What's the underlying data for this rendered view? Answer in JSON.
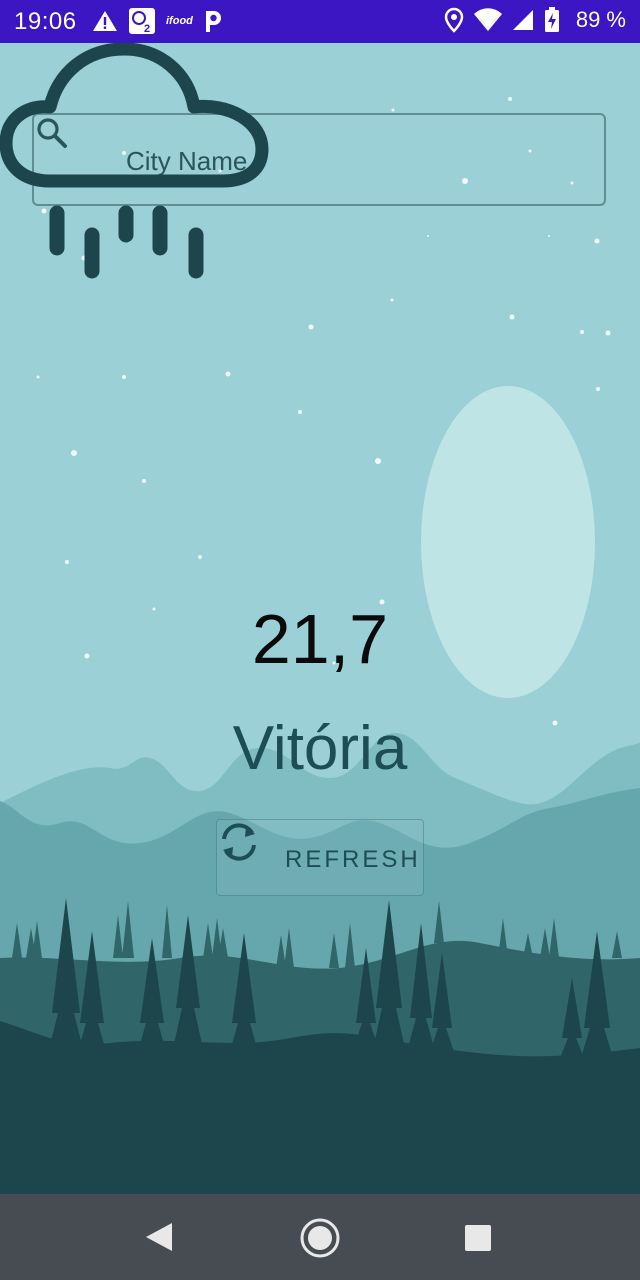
{
  "status_bar": {
    "time": "19:06",
    "battery_percent": "89 %",
    "notification_icons": [
      "warning-icon",
      "app-badge-icon",
      "ifood-icon",
      "p-icon"
    ],
    "ifood_label": "ifood",
    "system_icons": [
      "location-icon",
      "wifi-icon",
      "cell-signal-icon",
      "battery-charging-icon"
    ],
    "color": "#3b16c2"
  },
  "search": {
    "placeholder": "City Name",
    "value": ""
  },
  "weather": {
    "icon": "rain-cloud-icon",
    "temperature": "21,7",
    "city": "Vitória"
  },
  "refresh": {
    "label": "REFRESH",
    "icon": "refresh-icon"
  },
  "nav_bar": {
    "back": "back-icon",
    "home": "home-icon",
    "recents": "recents-icon"
  },
  "colors": {
    "sky": "#9ad0d6",
    "moon": "#bfe4e6",
    "mountains_far": "#80bdc2",
    "mountains_near": "#65a7ad",
    "forest_mid": "#306569",
    "forest_dark": "#1c464c",
    "text_dark": "#1d4d55"
  }
}
